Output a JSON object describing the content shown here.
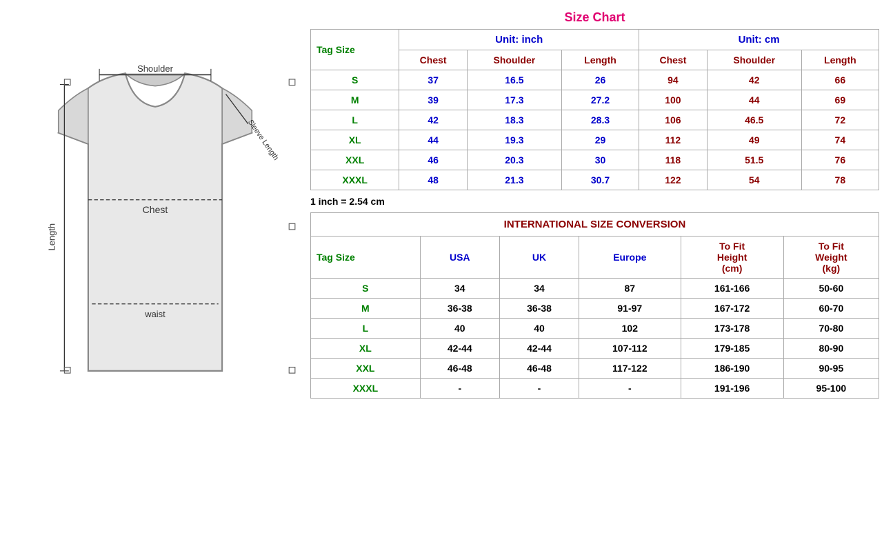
{
  "sizeChart": {
    "title": "Size Chart",
    "unitInch": "Unit: inch",
    "unitCm": "Unit: cm",
    "tagSizeLabel": "Tag Size",
    "headers": {
      "chest": "Chest",
      "shoulder": "Shoulder",
      "length": "Length"
    },
    "conversionNote": "1 inch = 2.54 cm",
    "rows": [
      {
        "tag": "S",
        "inch_chest": "37",
        "inch_shoulder": "16.5",
        "inch_length": "26",
        "cm_chest": "94",
        "cm_shoulder": "42",
        "cm_length": "66"
      },
      {
        "tag": "M",
        "inch_chest": "39",
        "inch_shoulder": "17.3",
        "inch_length": "27.2",
        "cm_chest": "100",
        "cm_shoulder": "44",
        "cm_length": "69"
      },
      {
        "tag": "L",
        "inch_chest": "42",
        "inch_shoulder": "18.3",
        "inch_length": "28.3",
        "cm_chest": "106",
        "cm_shoulder": "46.5",
        "cm_length": "72"
      },
      {
        "tag": "XL",
        "inch_chest": "44",
        "inch_shoulder": "19.3",
        "inch_length": "29",
        "cm_chest": "112",
        "cm_shoulder": "49",
        "cm_length": "74"
      },
      {
        "tag": "XXL",
        "inch_chest": "46",
        "inch_shoulder": "20.3",
        "inch_length": "30",
        "cm_chest": "118",
        "cm_shoulder": "51.5",
        "cm_length": "76"
      },
      {
        "tag": "XXXL",
        "inch_chest": "48",
        "inch_shoulder": "21.3",
        "inch_length": "30.7",
        "cm_chest": "122",
        "cm_shoulder": "54",
        "cm_length": "78"
      }
    ]
  },
  "intlConversion": {
    "title": "INTERNATIONAL SIZE CONVERSION",
    "tagSizeLabel": "Tag Size",
    "headers": {
      "usa": "USA",
      "uk": "UK",
      "europe": "Europe",
      "toFitHeight": "To Fit\nHeight\n(cm)",
      "toFitWeight": "To Fit\nWeight\n(kg)"
    },
    "rows": [
      {
        "tag": "S",
        "usa": "34",
        "uk": "34",
        "europe": "87",
        "height": "161-166",
        "weight": "50-60"
      },
      {
        "tag": "M",
        "usa": "36-38",
        "uk": "36-38",
        "europe": "91-97",
        "height": "167-172",
        "weight": "60-70"
      },
      {
        "tag": "L",
        "usa": "40",
        "uk": "40",
        "europe": "102",
        "height": "173-178",
        "weight": "70-80"
      },
      {
        "tag": "XL",
        "usa": "42-44",
        "uk": "42-44",
        "europe": "107-112",
        "height": "179-185",
        "weight": "80-90"
      },
      {
        "tag": "XXL",
        "usa": "46-48",
        "uk": "46-48",
        "europe": "117-122",
        "height": "186-190",
        "weight": "90-95"
      },
      {
        "tag": "XXXL",
        "usa": "-",
        "uk": "-",
        "europe": "-",
        "height": "191-196",
        "weight": "95-100"
      }
    ]
  }
}
